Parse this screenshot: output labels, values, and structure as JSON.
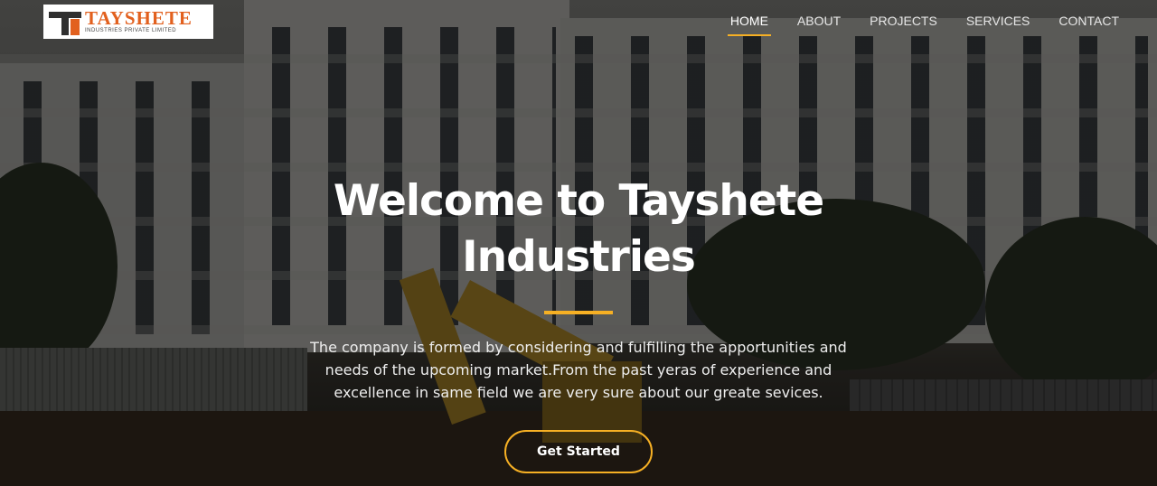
{
  "brand": {
    "name": "TAYSHETE",
    "tagline": "INDUSTRIES PRIVATE LIMITED",
    "accent_color": "#e2601e"
  },
  "nav": {
    "items": [
      {
        "label": "HOME",
        "active": true
      },
      {
        "label": "ABOUT",
        "active": false
      },
      {
        "label": "PROJECTS",
        "active": false
      },
      {
        "label": "SERVICES",
        "active": false
      },
      {
        "label": "CONTACT",
        "active": false
      }
    ],
    "highlight_color": "#f6b024"
  },
  "hero": {
    "title": "Welcome to Tayshete Industries",
    "description": "The company is formed by considering and fulfilling the apportunities and needs of the upcoming market.From the past yeras of experience and excellence in same field we are very sure about our greate sevices.",
    "cta_label": "Get Started",
    "accent_color": "#f6b024"
  }
}
